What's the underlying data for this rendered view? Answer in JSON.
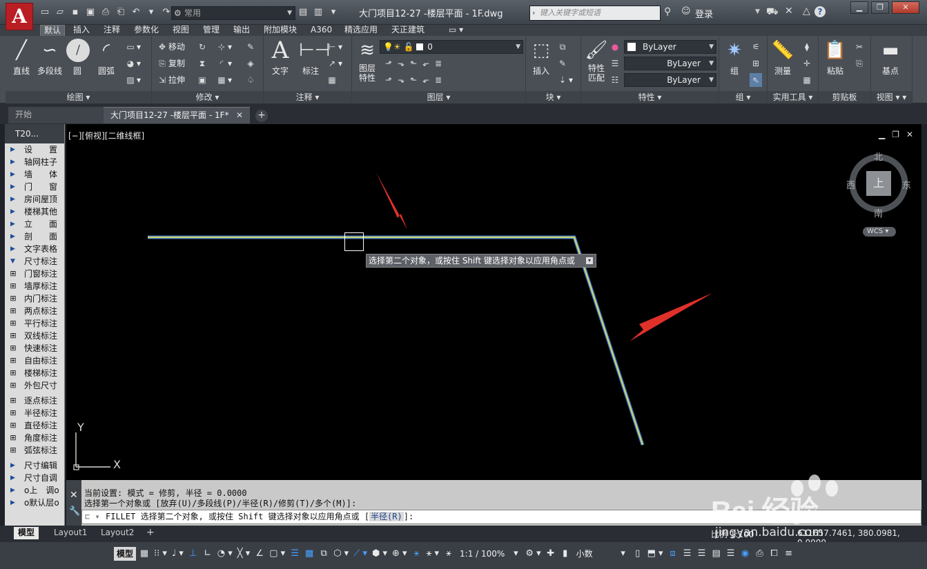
{
  "app": {
    "logo_letter": "A"
  },
  "titlebar": {
    "workspace": "常用",
    "document_title": "大门项目12-27 -楼层平面 - 1F.dwg",
    "search_placeholder": "键入关键字或短语",
    "login": "登录"
  },
  "ribbon_tabs": [
    "默认",
    "插入",
    "注释",
    "参数化",
    "视图",
    "管理",
    "输出",
    "附加模块",
    "A360",
    "精选应用",
    "天正建筑"
  ],
  "ribbon": {
    "draw": {
      "title": "绘图",
      "line": "直线",
      "polyline": "多段线",
      "circle": "圆",
      "arc": "圆弧"
    },
    "modify": {
      "title": "修改",
      "move": "移动",
      "copy": "复制",
      "stretch": "拉伸"
    },
    "annotation": {
      "title": "注释",
      "text": "文字",
      "dimension": "标注"
    },
    "layers": {
      "title": "图层",
      "layer_props": "图层\n特性",
      "layer_props_l1": "图层",
      "layer_props_l2": "特性",
      "current_layer": "0"
    },
    "block": {
      "title": "块",
      "insert": "插入"
    },
    "properties": {
      "title": "特性",
      "match": "特性\n匹配",
      "match_l1": "特性",
      "match_l2": "匹配",
      "color": "ByLayer",
      "linetype": "ByLayer",
      "lineweight": "ByLayer"
    },
    "groups": {
      "title": "组",
      "group": "组"
    },
    "utilities": {
      "title": "实用工具",
      "measure": "测量"
    },
    "clipboard": {
      "title": "剪贴板",
      "paste": "粘贴"
    },
    "view": {
      "title": "视图",
      "base": "基点"
    }
  },
  "file_tabs": {
    "start": "开始",
    "document": "大门项目12-27 -楼层平面 - 1F*"
  },
  "palette": {
    "header": "T20...",
    "menu_items": [
      "设　　置",
      "轴网柱子",
      "墙　　体",
      "门　　窗",
      "房间屋顶",
      "楼梯其他",
      "立　　面",
      "剖　　面",
      "文字表格",
      "尺寸标注"
    ],
    "dim_tools_a": [
      "门窗标注",
      "墙厚标注",
      "内门标注",
      "两点标注",
      "平行标注",
      "双线标注",
      "快速标注",
      "自由标注",
      "楼梯标注",
      "外包尺寸"
    ],
    "dim_tools_b": [
      "逐点标注",
      "半径标注",
      "直径标注",
      "角度标注",
      "弧弦标注"
    ],
    "dim_tools_c": [
      "尺寸编辑",
      "尺寸自调",
      "o上　调o",
      "o默认层o"
    ]
  },
  "viewport": {
    "label": "[−][俯视][二维线框]",
    "tooltip": "选择第二个对象，或按住 Shift 键选择对象以应用角点或",
    "compass": {
      "north": "北",
      "south": "南",
      "east": "东",
      "west": "西",
      "top": "上"
    },
    "wcs": "WCS",
    "ucs_y": "Y",
    "ucs_x": "X"
  },
  "command_line": {
    "history_1": "当前设置: 模式 = 修剪, 半径 = 0.0000",
    "history_2": "选择第一个对象或 [放弃(U)/多段线(P)/半径(R)/修剪(T)/多个(M)]:",
    "input_prefix": "FILLET 选择第二个对象, 或按住 Shift 键选择对象以应用角点或 [",
    "input_option": "半径(R)",
    "input_suffix": "]:"
  },
  "layout_tabs": [
    "模型",
    "Layout1",
    "Layout2"
  ],
  "status": {
    "model": "模型",
    "scale_label": "比例 1:100",
    "coords": "611657.7461, 380.0981, 0.0000",
    "annotation_scale": "1:1 / 100%",
    "units": "小数"
  },
  "watermark": {
    "text": "Bai 经验",
    "url": "jingyan.baidu.com"
  },
  "colors": {
    "canvas": "#000000",
    "drawn_line": "#c8d46a",
    "line_halo": "#3b6fd0",
    "arrow": "#e0302a",
    "ribbon_bg": "#4a4f56"
  }
}
